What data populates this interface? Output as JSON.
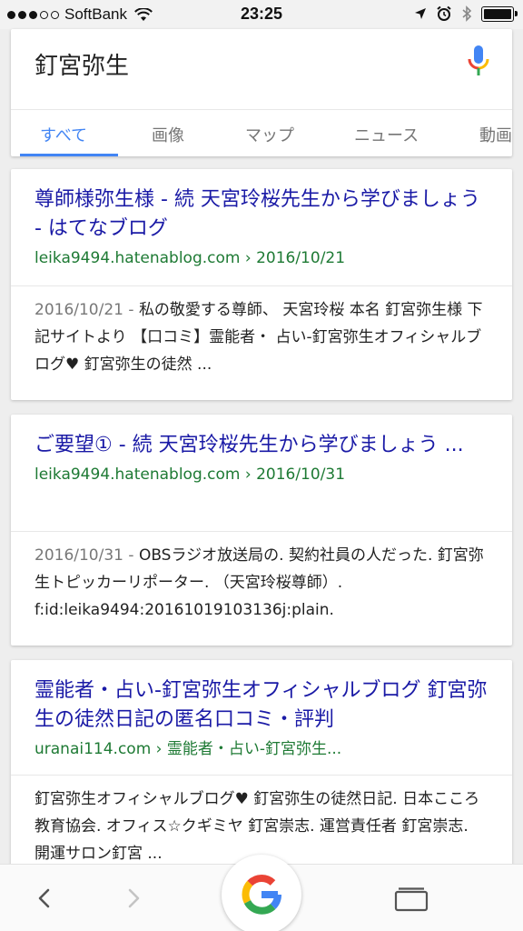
{
  "status_bar": {
    "carrier": "SoftBank",
    "time": "23:25"
  },
  "search": {
    "query": "釘宮弥生",
    "mic_icon": "mic-icon"
  },
  "tabs": [
    {
      "label": "すべて",
      "active": true
    },
    {
      "label": "画像"
    },
    {
      "label": "マップ"
    },
    {
      "label": "ニュース"
    },
    {
      "label": "動画"
    }
  ],
  "results": [
    {
      "title": "尊師様弥生様 - 続 天宮玲桜先生から学びましょう - はてなブログ",
      "url": "leika9494.hatenablog.com › 2016/10/21",
      "date": "2016/10/21 - ",
      "snippet": "私の敬愛する尊師、 天宮玲桜 本名 釘宮弥生様 下記サイトより 【口コミ】霊能者・ 占い-釘宮弥生オフィシャルブログ♥ 釘宮弥生の徒然 ..."
    },
    {
      "title": "ご要望① - 続 天宮玲桜先生から学びましょう ...",
      "url": "leika9494.hatenablog.com › 2016/10/31",
      "date": "2016/10/31 - ",
      "snippet": "OBSラジオ放送局の. 契約社員の人だった. 釘宮弥生トピッカーリポーター. （天宮玲桜尊師）. f:id:leika9494:20161019103136j:plain."
    },
    {
      "title": "霊能者・占い-釘宮弥生オフィシャルブログ 釘宮弥生の徒然日記の匿名口コミ・評判",
      "url": "uranai114.com › 霊能者・占い-釘宮弥生...",
      "date": "",
      "snippet": "釘宮弥生オフィシャルブログ♥ 釘宮弥生の徒然日記. 日本こころ教育協会. オフィス☆クギミヤ 釘宮崇志. 運営責任者 釘宮崇志. 開運サロン釘宮 ..."
    }
  ],
  "colors": {
    "link": "#1a1aa6",
    "url": "#1e7a34",
    "accent": "#4285f4"
  }
}
